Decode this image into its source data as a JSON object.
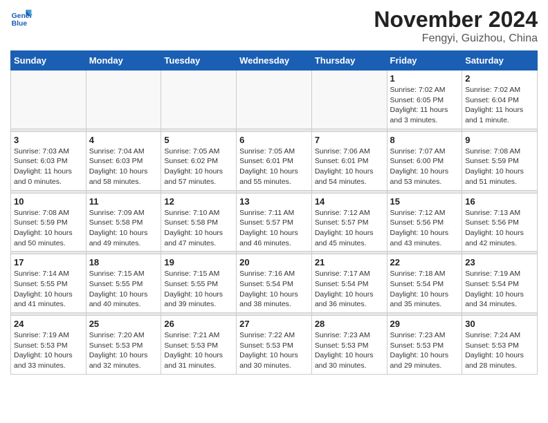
{
  "logo": {
    "line1": "General",
    "line2": "Blue"
  },
  "title": "November 2024",
  "location": "Fengyi, Guizhou, China",
  "days_header": [
    "Sunday",
    "Monday",
    "Tuesday",
    "Wednesday",
    "Thursday",
    "Friday",
    "Saturday"
  ],
  "weeks": [
    [
      {
        "day": "",
        "info": ""
      },
      {
        "day": "",
        "info": ""
      },
      {
        "day": "",
        "info": ""
      },
      {
        "day": "",
        "info": ""
      },
      {
        "day": "",
        "info": ""
      },
      {
        "day": "1",
        "info": "Sunrise: 7:02 AM\nSunset: 6:05 PM\nDaylight: 11 hours and 3 minutes."
      },
      {
        "day": "2",
        "info": "Sunrise: 7:02 AM\nSunset: 6:04 PM\nDaylight: 11 hours and 1 minute."
      }
    ],
    [
      {
        "day": "3",
        "info": "Sunrise: 7:03 AM\nSunset: 6:03 PM\nDaylight: 11 hours and 0 minutes."
      },
      {
        "day": "4",
        "info": "Sunrise: 7:04 AM\nSunset: 6:03 PM\nDaylight: 10 hours and 58 minutes."
      },
      {
        "day": "5",
        "info": "Sunrise: 7:05 AM\nSunset: 6:02 PM\nDaylight: 10 hours and 57 minutes."
      },
      {
        "day": "6",
        "info": "Sunrise: 7:05 AM\nSunset: 6:01 PM\nDaylight: 10 hours and 55 minutes."
      },
      {
        "day": "7",
        "info": "Sunrise: 7:06 AM\nSunset: 6:01 PM\nDaylight: 10 hours and 54 minutes."
      },
      {
        "day": "8",
        "info": "Sunrise: 7:07 AM\nSunset: 6:00 PM\nDaylight: 10 hours and 53 minutes."
      },
      {
        "day": "9",
        "info": "Sunrise: 7:08 AM\nSunset: 5:59 PM\nDaylight: 10 hours and 51 minutes."
      }
    ],
    [
      {
        "day": "10",
        "info": "Sunrise: 7:08 AM\nSunset: 5:59 PM\nDaylight: 10 hours and 50 minutes."
      },
      {
        "day": "11",
        "info": "Sunrise: 7:09 AM\nSunset: 5:58 PM\nDaylight: 10 hours and 49 minutes."
      },
      {
        "day": "12",
        "info": "Sunrise: 7:10 AM\nSunset: 5:58 PM\nDaylight: 10 hours and 47 minutes."
      },
      {
        "day": "13",
        "info": "Sunrise: 7:11 AM\nSunset: 5:57 PM\nDaylight: 10 hours and 46 minutes."
      },
      {
        "day": "14",
        "info": "Sunrise: 7:12 AM\nSunset: 5:57 PM\nDaylight: 10 hours and 45 minutes."
      },
      {
        "day": "15",
        "info": "Sunrise: 7:12 AM\nSunset: 5:56 PM\nDaylight: 10 hours and 43 minutes."
      },
      {
        "day": "16",
        "info": "Sunrise: 7:13 AM\nSunset: 5:56 PM\nDaylight: 10 hours and 42 minutes."
      }
    ],
    [
      {
        "day": "17",
        "info": "Sunrise: 7:14 AM\nSunset: 5:55 PM\nDaylight: 10 hours and 41 minutes."
      },
      {
        "day": "18",
        "info": "Sunrise: 7:15 AM\nSunset: 5:55 PM\nDaylight: 10 hours and 40 minutes."
      },
      {
        "day": "19",
        "info": "Sunrise: 7:15 AM\nSunset: 5:55 PM\nDaylight: 10 hours and 39 minutes."
      },
      {
        "day": "20",
        "info": "Sunrise: 7:16 AM\nSunset: 5:54 PM\nDaylight: 10 hours and 38 minutes."
      },
      {
        "day": "21",
        "info": "Sunrise: 7:17 AM\nSunset: 5:54 PM\nDaylight: 10 hours and 36 minutes."
      },
      {
        "day": "22",
        "info": "Sunrise: 7:18 AM\nSunset: 5:54 PM\nDaylight: 10 hours and 35 minutes."
      },
      {
        "day": "23",
        "info": "Sunrise: 7:19 AM\nSunset: 5:54 PM\nDaylight: 10 hours and 34 minutes."
      }
    ],
    [
      {
        "day": "24",
        "info": "Sunrise: 7:19 AM\nSunset: 5:53 PM\nDaylight: 10 hours and 33 minutes."
      },
      {
        "day": "25",
        "info": "Sunrise: 7:20 AM\nSunset: 5:53 PM\nDaylight: 10 hours and 32 minutes."
      },
      {
        "day": "26",
        "info": "Sunrise: 7:21 AM\nSunset: 5:53 PM\nDaylight: 10 hours and 31 minutes."
      },
      {
        "day": "27",
        "info": "Sunrise: 7:22 AM\nSunset: 5:53 PM\nDaylight: 10 hours and 30 minutes."
      },
      {
        "day": "28",
        "info": "Sunrise: 7:23 AM\nSunset: 5:53 PM\nDaylight: 10 hours and 30 minutes."
      },
      {
        "day": "29",
        "info": "Sunrise: 7:23 AM\nSunset: 5:53 PM\nDaylight: 10 hours and 29 minutes."
      },
      {
        "day": "30",
        "info": "Sunrise: 7:24 AM\nSunset: 5:53 PM\nDaylight: 10 hours and 28 minutes."
      }
    ]
  ]
}
